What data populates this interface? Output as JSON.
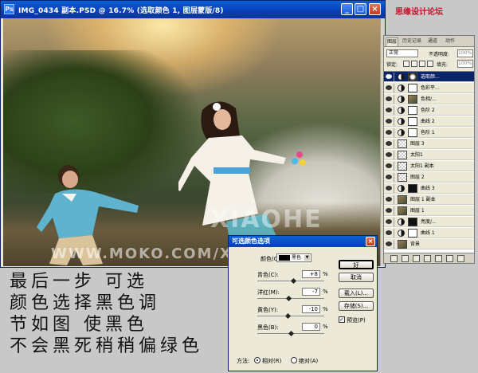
{
  "document": {
    "title": "IMG_0434 副本.PSD @ 16.7% (选取颜色 1, 图层蒙版/8)",
    "app_icon": "Ps",
    "minimize": "_",
    "maximize": "□",
    "close": "×",
    "photo_watermark": "XIAOHE",
    "photo_url": "WWW.MOKO.COM/XIAOHE"
  },
  "site_logo": "思缘设计论坛",
  "layers_panel": {
    "tabs": [
      "图层",
      "历史记录",
      "通道",
      "动作"
    ],
    "blend_mode": "正常",
    "opacity_label": "不透明度:",
    "opacity_value": "100%",
    "lock_label": "锁定:",
    "fill_label": "填充:",
    "fill_value": "100%",
    "layers": [
      {
        "name": "选取颜...",
        "kind": "adj",
        "thumb": "mask",
        "selected": true
      },
      {
        "name": "色彩平...",
        "kind": "adj",
        "thumb": "white"
      },
      {
        "name": "色相/...",
        "kind": "adj",
        "thumb": "pic"
      },
      {
        "name": "色阶 2",
        "kind": "adj",
        "thumb": "white"
      },
      {
        "name": "曲线 2",
        "kind": "adj",
        "thumb": "white"
      },
      {
        "name": "色阶 1",
        "kind": "adj",
        "thumb": "white"
      },
      {
        "name": "图层 3",
        "kind": "pixel",
        "thumb": "check"
      },
      {
        "name": "太阳1",
        "kind": "pixel",
        "thumb": "check"
      },
      {
        "name": "太阳1 副本",
        "kind": "pixel",
        "thumb": "check"
      },
      {
        "name": "图层 2",
        "kind": "pixel",
        "thumb": "check"
      },
      {
        "name": "曲线 3",
        "kind": "adj",
        "thumb": "black"
      },
      {
        "name": "图层 1 副本",
        "kind": "pixel",
        "thumb": "pic"
      },
      {
        "name": "图层 1",
        "kind": "pixel",
        "thumb": "pic"
      },
      {
        "name": "亮度/...",
        "kind": "adj",
        "thumb": "black"
      },
      {
        "name": "曲线 1",
        "kind": "adj",
        "thumb": "white"
      },
      {
        "name": "背景",
        "kind": "pixel",
        "thumb": "pic"
      }
    ]
  },
  "instructions": [
    "最后一步   可选",
    "颜色选择黑色调",
    "节如图  使黑色",
    "不会黑死稍稍偏绿色"
  ],
  "dialog": {
    "title": "可选颜色选项",
    "close": "×",
    "colors_label": "颜色(O):",
    "colors_value": "黑色",
    "sliders": [
      {
        "label": "青色(C):",
        "value": "+8",
        "unit": "%",
        "amount": 8
      },
      {
        "label": "洋红(M):",
        "value": "-7",
        "unit": "%",
        "amount": -7
      },
      {
        "label": "黄色(Y):",
        "value": "-10",
        "unit": "%",
        "amount": -10
      },
      {
        "label": "黑色(B):",
        "value": "0",
        "unit": "%",
        "amount": 0
      }
    ],
    "buttons": {
      "ok": "好",
      "cancel": "取消",
      "load": "载入(L)...",
      "save": "存储(S)..."
    },
    "preview_label": "预览(P)",
    "preview_checked": true,
    "method_label": "方法:",
    "method_relative": "相对(R)",
    "method_absolute": "绝对(A)",
    "method_selected": "relative"
  }
}
